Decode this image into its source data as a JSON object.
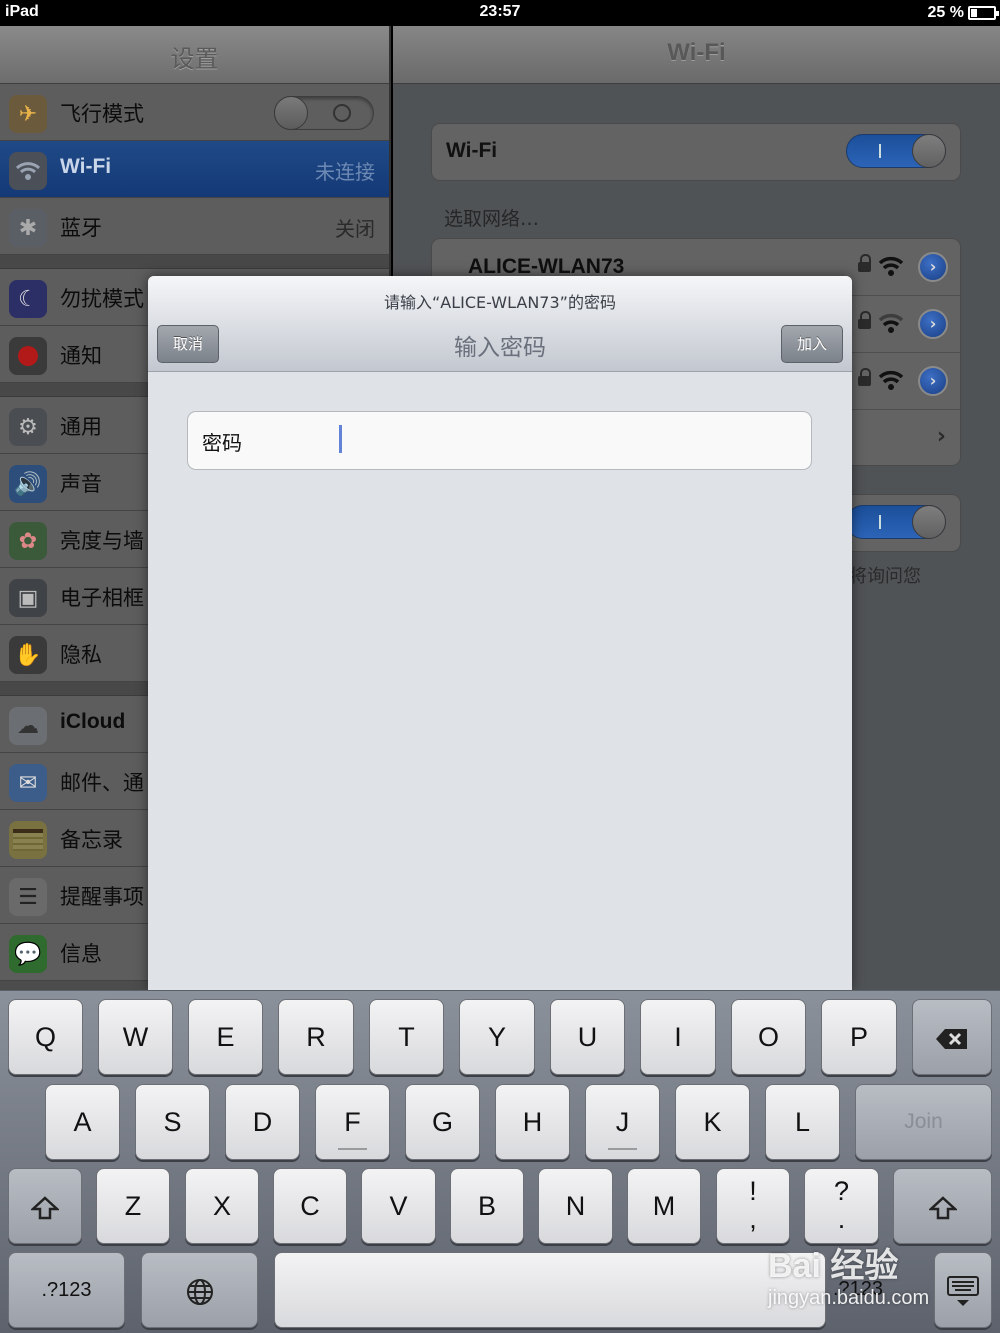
{
  "status_bar": {
    "device": "iPad",
    "time": "23:57",
    "battery_text": "25 %",
    "battery_level": 0.25
  },
  "settings": {
    "title": "设置",
    "items": [
      {
        "label": "飞行模式",
        "value": "",
        "icon": "airplane-icon"
      },
      {
        "label": "Wi-Fi",
        "value": "未连接",
        "icon": "wifi-icon"
      },
      {
        "label": "蓝牙",
        "value": "关闭",
        "icon": "bluetooth-icon"
      },
      {
        "label": "勿扰模式",
        "icon": "moon-icon"
      },
      {
        "label": "通知",
        "icon": "notification-icon"
      },
      {
        "label": "通用",
        "icon": "gear-icon"
      },
      {
        "label": "声音",
        "icon": "speaker-icon"
      },
      {
        "label": "亮度与墙",
        "icon": "flower-icon"
      },
      {
        "label": "电子相框",
        "icon": "picture-frame-icon"
      },
      {
        "label": "隐私",
        "icon": "hand-icon"
      },
      {
        "label": "iCloud",
        "icon": "cloud-icon"
      },
      {
        "label": "邮件、通",
        "icon": "mail-icon"
      },
      {
        "label": "备忘录",
        "icon": "notes-icon"
      },
      {
        "label": "提醒事项",
        "icon": "reminders-icon"
      },
      {
        "label": "信息",
        "icon": "messages-icon"
      }
    ]
  },
  "wifi": {
    "title": "Wi-Fi",
    "toggle_label": "Wi-Fi",
    "toggle_on": true,
    "choose_label": "选取网络…",
    "networks": [
      {
        "name": "ALICE-WLAN73"
      },
      {
        "name": ""
      },
      {
        "name": ""
      }
    ],
    "ask_note": "将询问您"
  },
  "dialog": {
    "prompt": "请输入“ALICE-WLAN73”的密码",
    "title": "输入密码",
    "cancel_label": "取消",
    "join_label": "加入",
    "password_label": "密码",
    "password_value": ""
  },
  "keyboard": {
    "row1": [
      "Q",
      "W",
      "E",
      "R",
      "T",
      "Y",
      "U",
      "I",
      "O",
      "P"
    ],
    "row2": [
      "A",
      "S",
      "D",
      "F",
      "G",
      "H",
      "J",
      "K",
      "L"
    ],
    "row3": [
      "Z",
      "X",
      "C",
      "V",
      "B",
      "N",
      "M"
    ],
    "join_label": "Join",
    "excl_top": "!",
    "excl_bottom": ",",
    "q_top": "?",
    "q_bottom": ".",
    "num_label": ".?123",
    "num_label_right": ".?123"
  },
  "watermark": {
    "brand": "Bai  经验",
    "url": "jingyan.baidu.com"
  }
}
